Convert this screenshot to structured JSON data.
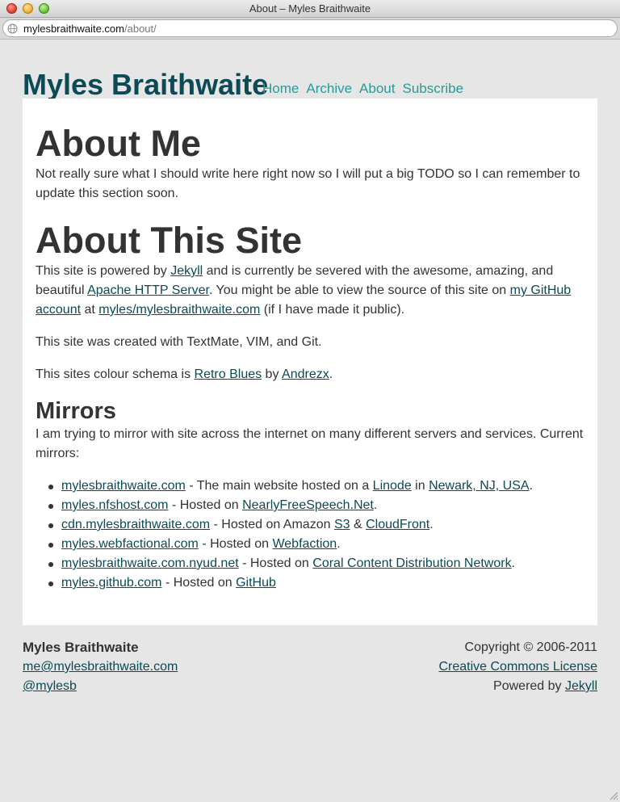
{
  "window": {
    "title": "About – Myles Braithwaite",
    "url_host": "mylesbraithwaite.com",
    "url_path": "/about/"
  },
  "header": {
    "site_title": "Myles Braithwaite",
    "nav": [
      "Home",
      "Archive",
      "About",
      "Subscribe"
    ]
  },
  "about_me": {
    "heading": "About Me",
    "text": "Not really sure what I should write here right now so I will put a big TODO so I can remember to update this section soon."
  },
  "about_site": {
    "heading": "About This Site",
    "p1_a": "This site is powered by ",
    "p1_link1": "Jekyll",
    "p1_b": " and is currently be severed with the awesome, amazing, and beautiful ",
    "p1_link2": "Apache HTTP Server",
    "p1_c": ". You might be able to view the source of this site on ",
    "p1_link3": "my GitHub account",
    "p1_d": " at ",
    "p1_link4": "myles/mylesbraithwaite.com",
    "p1_e": " (if I have made it public).",
    "p2": "This site was created with TextMate, VIM, and Git.",
    "p3_a": "This sites colour schema is ",
    "p3_link1": "Retro Blues",
    "p3_b": " by ",
    "p3_link2": "Andrezx",
    "p3_c": "."
  },
  "mirrors": {
    "heading": "Mirrors",
    "intro": "I am trying to mirror with site across the internet on many different servers and services. Current mirrors:",
    "items": [
      {
        "link": "mylesbraithwaite.com",
        "text_a": " - The main website hosted on a ",
        "link2": "Linode",
        "text_b": " in ",
        "link3": "Newark, NJ, USA",
        "text_c": "."
      },
      {
        "link": "myles.nfshost.com",
        "text_a": " - Hosted on ",
        "link2": "NearlyFreeSpeech.Net",
        "text_b": "."
      },
      {
        "link": "cdn.mylesbraithwaite.com",
        "text_a": " - Hosted on Amazon ",
        "link2": "S3",
        "text_b": " & ",
        "link3": "CloudFront",
        "text_c": "."
      },
      {
        "link": "myles.webfactional.com",
        "text_a": " - Hosted on ",
        "link2": "Webfaction",
        "text_b": "."
      },
      {
        "link": "mylesbraithwaite.com.nyud.net",
        "text_a": " - Hosted on ",
        "link2": "Coral Content Distribution Network",
        "text_b": "."
      },
      {
        "link": "myles.github.com",
        "text_a": " - Hosted on ",
        "link2": "GitHub"
      }
    ]
  },
  "footer": {
    "name": "Myles Braithwaite",
    "email": "me@mylesbraithwaite.com",
    "twitter": "@mylesb",
    "copyright": "Copyright © 2006-2011",
    "license": "Creative Commons License",
    "powered_a": "Powered by ",
    "powered_link": "Jekyll"
  },
  "colors": {
    "title": "#0c4a55",
    "nav": "#2a9a96",
    "link": "#0c4a55",
    "background": "#e6e6e6"
  }
}
